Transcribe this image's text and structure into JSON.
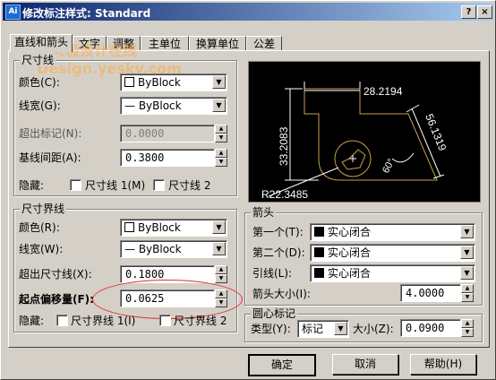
{
  "window": {
    "app_icon_text": "Ai",
    "title": "修改标注样式: Standard",
    "help_btn": "?",
    "close_btn": "×"
  },
  "tabs": [
    "直线和箭头",
    "文字",
    "调整",
    "主单位",
    "换算单位",
    "公差"
  ],
  "watermark": {
    "line1": "天极设计在线",
    "line2": "Design.yesky.com"
  },
  "dim_lines": {
    "title": "尺寸线",
    "color_label": "颜色(C):",
    "color_value": "ByBlock",
    "lineweight_label": "线宽(G):",
    "lineweight_value": "— ByBlock",
    "extend_label": "超出标记(N):",
    "extend_value": "0.0000",
    "baseline_label": "基线间距(A):",
    "baseline_value": "0.3800",
    "suppress_label": "隐藏:",
    "suppress1": "尺寸线 1(M)",
    "suppress2": "尺寸线 2"
  },
  "ext_lines": {
    "title": "尺寸界线",
    "color_label": "颜色(R):",
    "color_value": "ByBlock",
    "lineweight_label": "线宽(W):",
    "lineweight_value": "— ByBlock",
    "extend_label": "超出尺寸线(X):",
    "extend_value": "0.1800",
    "offset_label": "起点偏移量(F):",
    "offset_value": "0.0625",
    "suppress_label": "隐藏:",
    "suppress1": "尺寸界线 1(I)",
    "suppress2": "尺寸界线 2"
  },
  "arrowheads": {
    "title": "箭头",
    "first_label": "第一个(T):",
    "first_value": "实心闭合",
    "second_label": "第二个(D):",
    "second_value": "实心闭合",
    "leader_label": "引线(L):",
    "leader_value": "实心闭合",
    "size_label": "箭头大小(I):",
    "size_value": "4.0000"
  },
  "center_marks": {
    "title": "圆心标记",
    "type_label": "类型(Y):",
    "type_value": "标记",
    "size_label": "大小(Z):",
    "size_value": "0.0900"
  },
  "preview": {
    "dim_top": "28.2194",
    "dim_left": "33.2083",
    "dim_right": "56.1319",
    "dim_angle": "60°",
    "dim_radius": "R22.3485",
    "accent_line": "#c8a050",
    "dim_color": "#ffffff"
  },
  "buttons": {
    "ok": "确定",
    "cancel": "取消",
    "help": "帮助(H)"
  },
  "highlight_color": "#e03030"
}
